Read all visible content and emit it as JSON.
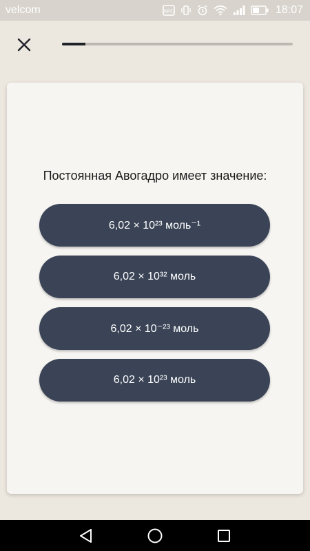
{
  "status_bar": {
    "carrier": "velcom",
    "nfc_label": "NFC",
    "time": "18:07"
  },
  "top_bar": {
    "close_icon": "close-icon",
    "progress": 0.1
  },
  "quiz": {
    "question": "Постоянная Авогадро имеет значение:",
    "answers": [
      "6,02 × 10²³ моль⁻¹",
      "6,02 × 10³² моль",
      "6,02 × 10⁻²³ моль",
      "6,02 × 10²³ моль"
    ]
  },
  "nav_bar": {
    "icons": [
      "back-icon",
      "home-icon",
      "recents-icon"
    ]
  },
  "colors": {
    "background": "#ece7df",
    "card": "#f7f5f2",
    "answer_button": "#3a4456",
    "progress_fill": "#1f2229",
    "progress_track": "#bcb8b2"
  }
}
